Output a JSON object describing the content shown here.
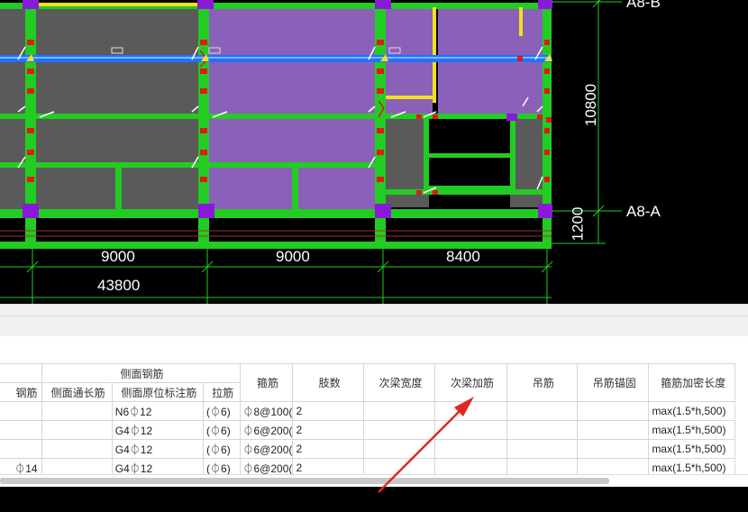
{
  "drawing": {
    "axis_label_top": "A8-B",
    "axis_label_mid": "A8-A",
    "span_dims": [
      "9000",
      "9000",
      "8400"
    ],
    "total_dim": "43800",
    "vertical_dims": [
      "10800",
      "1200"
    ],
    "colors": {
      "beam_green": "#22cc22",
      "slab_gray": "#5a5a5a",
      "slab_purple": "#8a60b8",
      "beam_blue": "#1e73ff",
      "highlight_yellow": "#f0e020",
      "column_purple": "#8a18d8",
      "rebar_red": "#e01818",
      "background": "#000000"
    }
  },
  "table": {
    "group_header": "侧面钢筋",
    "headers": {
      "col0": "钢筋",
      "col1": "侧面通长筋",
      "col2": "侧面原位标注筋",
      "col3": "拉筋",
      "col4": "箍筋",
      "col5": "肢数",
      "col6": "次梁宽度",
      "col7": "次梁加筋",
      "col8": "吊筋",
      "col9": "吊筋锚固",
      "col10": "箍筋加密长度"
    },
    "rows": [
      {
        "c0": "",
        "c1": "",
        "c2": "N6⏀12",
        "c3": "(⏀6)",
        "c4": "⏀8@100(",
        "c5": "2",
        "c6": "",
        "c7": "",
        "c8": "",
        "c9": "",
        "c10": "max(1.5*h,500)"
      },
      {
        "c0": "",
        "c1": "",
        "c2": "G4⏀12",
        "c3": "(⏀6)",
        "c4": "⏀6@200(",
        "c5": "2",
        "c6": "",
        "c7": "",
        "c8": "",
        "c9": "",
        "c10": "max(1.5*h,500)"
      },
      {
        "c0": "",
        "c1": "",
        "c2": "G4⏀12",
        "c3": "(⏀6)",
        "c4": "⏀6@200(",
        "c5": "2",
        "c6": "",
        "c7": "",
        "c8": "",
        "c9": "",
        "c10": "max(1.5*h,500)"
      },
      {
        "c0": "⏀14",
        "c1": "",
        "c2": "G4⏀12",
        "c3": "(⏀6)",
        "c4": "⏀6@200(",
        "c5": "2",
        "c6": "",
        "c7": "",
        "c8": "",
        "c9": "",
        "c10": "max(1.5*h,500)"
      }
    ]
  },
  "annotation": {
    "arrow_color": "#e0281e"
  }
}
